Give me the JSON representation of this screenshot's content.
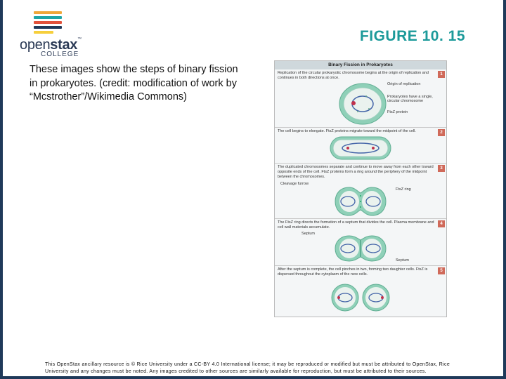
{
  "logo": {
    "text_light": "open",
    "text_bold": "stax",
    "trademark": "™",
    "subtext": "COLLEGE",
    "bar_colors": [
      "#f0a73a",
      "#1ea5a7",
      "#e2523b",
      "#1f3a5a",
      "#f6cf3c",
      "#1f3a5a"
    ]
  },
  "figure_title": "FIGURE 10. 15",
  "caption": "These images show the steps of binary fission in prokaryotes. (credit: modification of work by “Mcstrother”/Wikimedia Commons)",
  "figure": {
    "header": "Binary Fission in Prokaryotes",
    "steps": [
      {
        "num": "1",
        "text": "Replication of the circular prokaryotic chromosome begins at the origin of replication and continues in both directions at once."
      },
      {
        "num": "2",
        "text": "The cell begins to elongate. FtsZ proteins migrate toward the midpoint of the cell."
      },
      {
        "num": "3",
        "text": "The duplicated chromosomes separate and continue to move away from each other toward opposite ends of the cell. FtsZ proteins form a ring around the periphery of the midpoint between the chromosomes."
      },
      {
        "num": "4",
        "text": "The FtsZ ring directs the formation of a septum that divides the cell. Plasma membrane and cell wall materials accumulate."
      },
      {
        "num": "5",
        "text": "After the septum is complete, the cell pinches in two, forming two daughter cells. FtsZ is dispersed throughout the cytoplasm of the new cells."
      }
    ],
    "labels": {
      "origin": "Origin of replication",
      "chromosome": "Prokaryotes have a single, circular chromosome",
      "ftsz": "FtsZ protein",
      "furrow": "Cleavage furrow",
      "ring": "FtsZ ring",
      "septum_top": "Septum",
      "septum_bottom": "Septum"
    }
  },
  "footer": "This OpenStax ancillary resource is © Rice University under a CC-BY 4.0 International license; it may be reproduced or modified but must be attributed to OpenStax, Rice University and any changes must be noted. Any images credited to other sources are similarly available for reproduction, but must be attributed to their sources."
}
